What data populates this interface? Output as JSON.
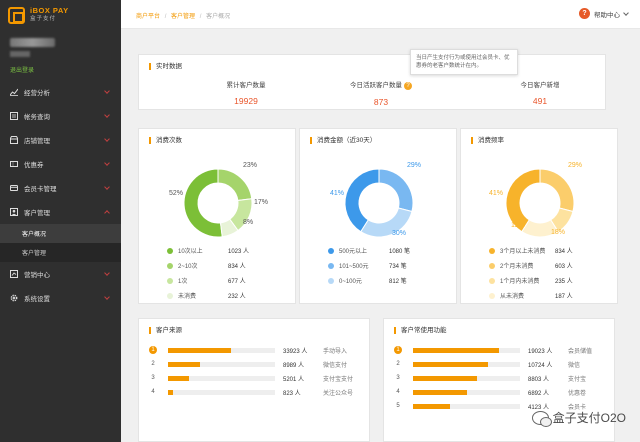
{
  "logo": {
    "en": "iBOX PAY",
    "cn": "盒子支付"
  },
  "user": {
    "logout": "退出登录"
  },
  "sidebar": {
    "items": [
      {
        "label": "经营分析",
        "icon": "trend-icon"
      },
      {
        "label": "帐务查询",
        "icon": "ledger-icon"
      },
      {
        "label": "店铺管理",
        "icon": "store-icon"
      },
      {
        "label": "优惠券",
        "icon": "coupon-icon"
      },
      {
        "label": "会员卡管理",
        "icon": "card-icon"
      },
      {
        "label": "客户管理",
        "icon": "user-icon"
      },
      {
        "label": "营销中心",
        "icon": "marketing-icon"
      },
      {
        "label": "系统设置",
        "icon": "gear-icon"
      }
    ],
    "sub": [
      {
        "label": "客户概况"
      },
      {
        "label": "客户管理"
      }
    ]
  },
  "breadcrumb": {
    "a": "商户平台",
    "b": "客户管理",
    "c": "客户概况",
    "sep": "/"
  },
  "help": {
    "label": "帮助中心",
    "icon_glyph": "?"
  },
  "realtime": {
    "title": "实时数据",
    "stats": [
      {
        "label": "累计客户数量",
        "value": "19929"
      },
      {
        "label": "今日活跃客户数量",
        "value": "873"
      },
      {
        "label": "今日客户新增",
        "value": "491"
      }
    ],
    "tooltip": "当日产生支付行为或使用过会员卡、优惠券的老客户数统计在内。",
    "help_glyph": "?"
  },
  "donuts": [
    {
      "title": "消费次数",
      "colors": [
        "#7cbf37",
        "#a5d46b",
        "#c7e69e",
        "#e8f3d8"
      ],
      "pcts": [
        "52%",
        "23%",
        "17%",
        "8%"
      ],
      "legend": [
        {
          "name": "10次以上",
          "value": "1023 人"
        },
        {
          "name": "2~10次",
          "value": "834 人"
        },
        {
          "name": "1次",
          "value": "677 人"
        },
        {
          "name": "未消费",
          "value": "232 人"
        }
      ]
    },
    {
      "title": "消费金额（近30天）",
      "colors": [
        "#3d99ea",
        "#79b8f1",
        "#b7d9f7"
      ],
      "pcts": [
        "41%",
        "29%",
        "30%"
      ],
      "legend": [
        {
          "name": "500元以上",
          "value": "1080 笔"
        },
        {
          "name": "101~500元",
          "value": "734 笔"
        },
        {
          "name": "0~100元",
          "value": "812 笔"
        }
      ]
    },
    {
      "title": "消费频率",
      "colors": [
        "#f7b32b",
        "#fbcd6b",
        "#fde29f",
        "#fef1cf"
      ],
      "pcts": [
        "41%",
        "29%",
        "12%",
        "18%"
      ],
      "legend": [
        {
          "name": "3个月以上未消费",
          "value": "834 人"
        },
        {
          "name": "2个月未消费",
          "value": "603 人"
        },
        {
          "name": "1个月内未消费",
          "value": "235 人"
        },
        {
          "name": "从未消费",
          "value": "187 人"
        }
      ]
    }
  ],
  "sources": {
    "title": "客户来源",
    "rows": [
      {
        "rank": "1",
        "count": "33923 人",
        "name": "手动导入",
        "fill": 0.59
      },
      {
        "rank": "2",
        "count": "8989 人",
        "name": "微信支付",
        "fill": 0.3
      },
      {
        "rank": "3",
        "count": "5201 人",
        "name": "支付宝支付",
        "fill": 0.2
      },
      {
        "rank": "4",
        "count": "823 人",
        "name": "关注公众号",
        "fill": 0.05
      }
    ]
  },
  "features": {
    "title": "客户常使用功能",
    "rows": [
      {
        "rank": "1",
        "count": "19023 人",
        "name": "会员储值",
        "fill": 0.8
      },
      {
        "rank": "2",
        "count": "10724 人",
        "name": "微信",
        "fill": 0.7
      },
      {
        "rank": "3",
        "count": "8803 人",
        "name": "支付宝",
        "fill": 0.6
      },
      {
        "rank": "4",
        "count": "6892 人",
        "name": "优惠卷",
        "fill": 0.5
      },
      {
        "rank": "5",
        "count": "4123 人",
        "name": "会员卡",
        "fill": 0.35
      }
    ]
  },
  "watermark": "盒子支付O2O"
}
